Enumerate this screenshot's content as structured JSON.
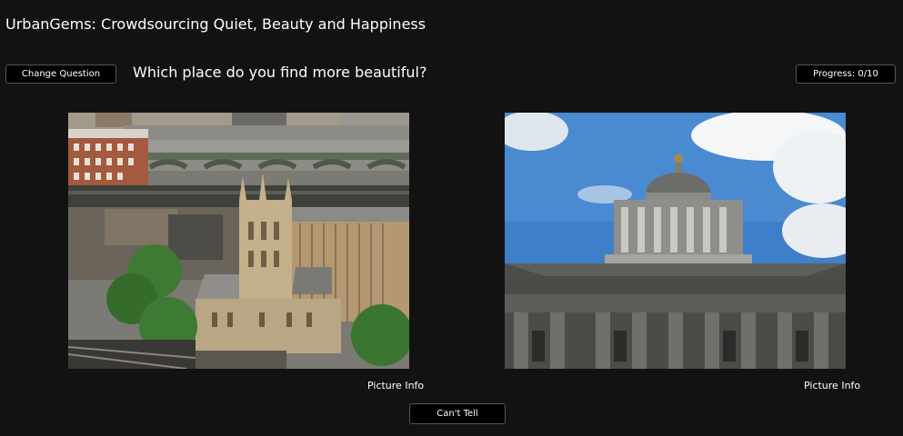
{
  "header": {
    "app_title": "UrbanGems: Crowdsourcing Quiet, Beauty and Happiness"
  },
  "toolbar": {
    "change_question_label": "Change Question",
    "question": "Which place do you find more beautiful?",
    "progress_label": "Progress: 0/10"
  },
  "choices": {
    "left": {
      "info_label": "Picture Info",
      "image_description": "aerial-view-cathedral-river-bridge"
    },
    "right": {
      "info_label": "Picture Info",
      "image_description": "domed-stone-building-blue-sky"
    }
  },
  "footer": {
    "cant_tell_label": "Can't Tell"
  },
  "colors": {
    "background": "#121212",
    "button_bg": "#000000",
    "text": "#ffffff"
  }
}
